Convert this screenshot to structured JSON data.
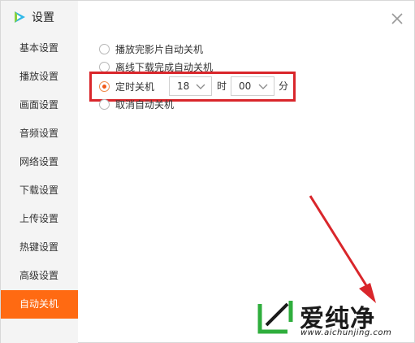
{
  "window": {
    "title": "设置",
    "logo_icon": "play-logo-icon",
    "close_icon": "close-icon"
  },
  "sidebar": {
    "items": [
      {
        "label": "基本设置"
      },
      {
        "label": "播放设置"
      },
      {
        "label": "画面设置"
      },
      {
        "label": "音频设置"
      },
      {
        "label": "网络设置"
      },
      {
        "label": "下载设置"
      },
      {
        "label": "上传设置"
      },
      {
        "label": "热键设置"
      },
      {
        "label": "高级设置"
      },
      {
        "label": "自动关机",
        "active": true
      }
    ]
  },
  "shutdown": {
    "options": [
      {
        "label": "播放完影片自动关机",
        "checked": false
      },
      {
        "label": "离线下载完成自动关机",
        "checked": false
      },
      {
        "label": "定时关机",
        "checked": true
      },
      {
        "label": "取消自动关机",
        "checked": false
      }
    ],
    "hour_value": "18",
    "hour_unit": "时",
    "minute_value": "00",
    "minute_unit": "分"
  },
  "watermark": {
    "title": "爱纯净",
    "url": "www.aichunjing.com"
  },
  "colors": {
    "accent": "#ff6a12",
    "highlight": "#d9262b",
    "watermark_logo": "#2fae3d"
  }
}
